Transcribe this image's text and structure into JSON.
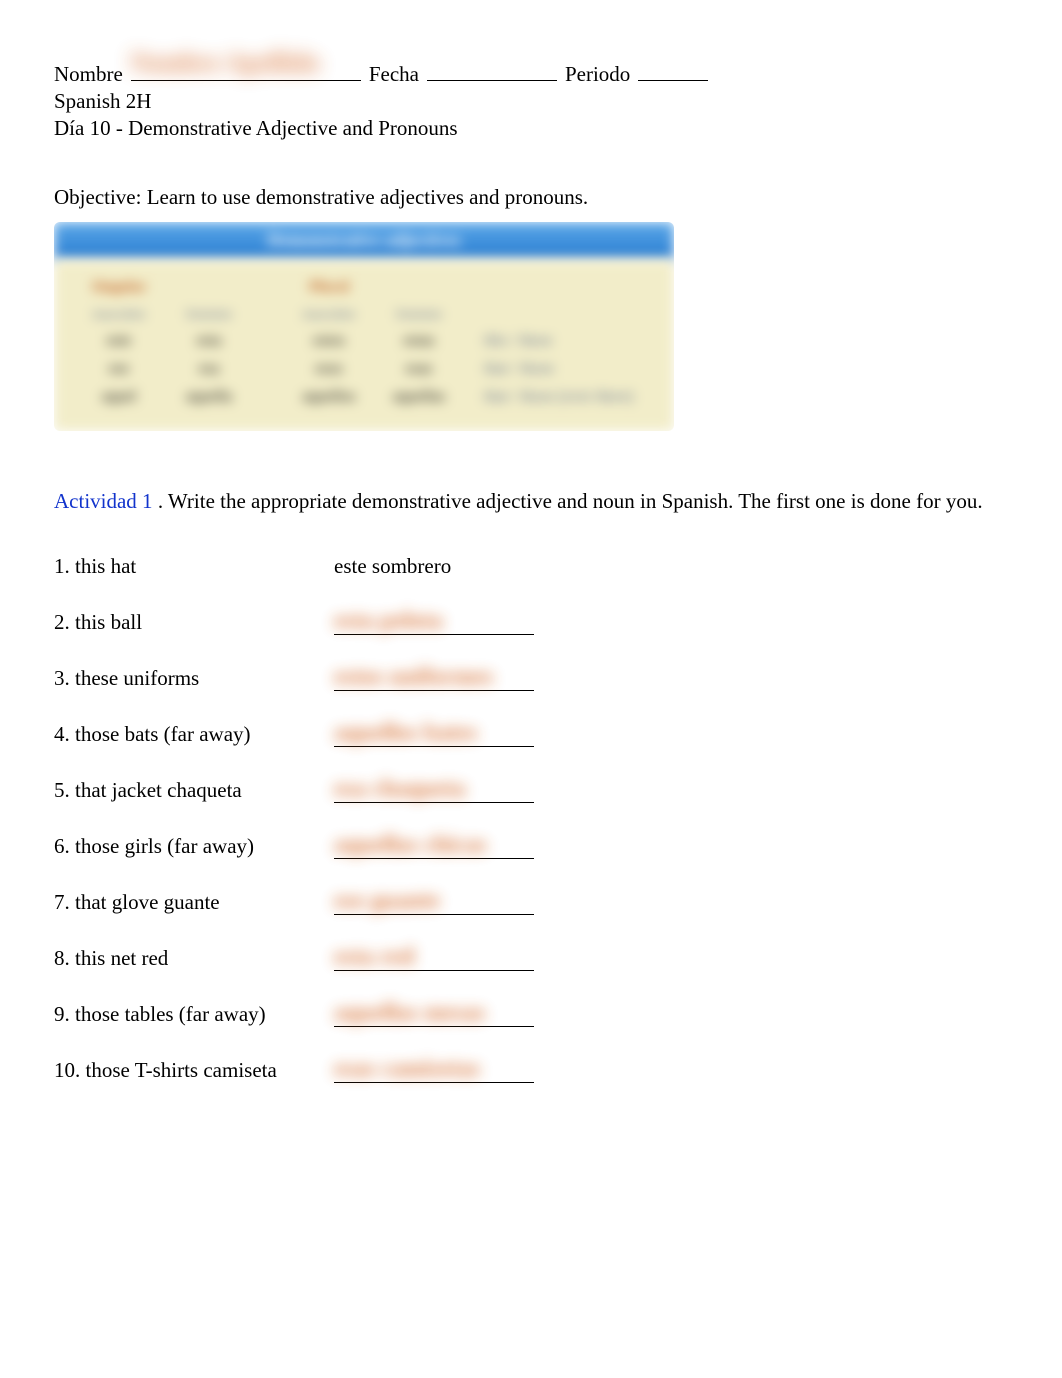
{
  "header": {
    "nombre_label": "Nombre",
    "fecha_label": "Fecha",
    "periodo_label": "Periodo",
    "course": "Spanish 2H",
    "lesson": "Día 10 - Demonstrative Adjective and Pronouns"
  },
  "objective": "Objective: Learn to use demonstrative adjectives and pronouns.",
  "activity": {
    "label": "Actividad 1",
    "instructions": ". Write the appropriate demonstrative adjective and noun in Spanish. The first one is done for you.",
    "items": [
      {
        "num": "1.",
        "prompt": "this hat",
        "answer": "este sombrero",
        "underlined": false
      },
      {
        "num": "2.",
        "prompt": "this ball",
        "answer": "esta pelota",
        "underlined": true
      },
      {
        "num": "3.",
        "prompt": "these uniforms",
        "answer": "estos uniformes",
        "underlined": true
      },
      {
        "num": "4.",
        "prompt": "those bats (far away)",
        "answer": "aquellos bates",
        "underlined": true
      },
      {
        "num": "5.",
        "prompt": "that jacket chaqueta",
        "answer": "esa chaqueta",
        "underlined": true
      },
      {
        "num": "6.",
        "prompt": "those girls (far away)",
        "answer": "aquellas chicas",
        "underlined": true
      },
      {
        "num": "7.",
        "prompt": "that glove guante",
        "answer": "ese guante",
        "underlined": true
      },
      {
        "num": "8.",
        "prompt": "this net red",
        "answer": "esta red",
        "underlined": true
      },
      {
        "num": "9.",
        "prompt": "those tables (far away)",
        "answer": "aquellas mesas",
        "underlined": true
      },
      {
        "num": "10.",
        "prompt": "those T-shirts camiseta",
        "answer": "esas camisetas",
        "underlined": true
      }
    ]
  },
  "chart_data": {
    "type": "table",
    "title": "Demonstrative adjectives",
    "groups": [
      "Singular",
      "Plural"
    ],
    "subheaders": [
      "masculine",
      "feminine",
      "masculine",
      "feminine"
    ],
    "rows": [
      {
        "cells": [
          "este",
          "esta",
          "estos",
          "estas"
        ],
        "gloss": "this / these"
      },
      {
        "cells": [
          "ese",
          "esa",
          "esos",
          "esas"
        ],
        "gloss": "that / those"
      },
      {
        "cells": [
          "aquel",
          "aquella",
          "aquellos",
          "aquellas"
        ],
        "gloss": "that / those (over there)"
      }
    ]
  },
  "blur_scribble": "Nombre Apellido"
}
